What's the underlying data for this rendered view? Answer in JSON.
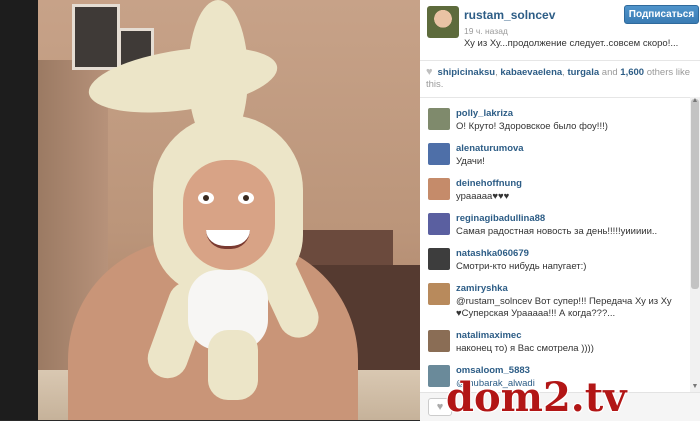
{
  "post": {
    "username": "rustam_solncev",
    "follow_label": "Подписаться",
    "time_ago": "19 ч. назад",
    "caption": "Ху из Ху...продолжение следует..совсем скоро!..."
  },
  "likes": {
    "heart_icon": "heart-icon",
    "likers": [
      "shipicinaksu",
      "kabaevaelena",
      "turgala"
    ],
    "sep1": ", ",
    "sep2": ", ",
    "and_text": " and ",
    "more_count": "1,600",
    "more_text": " others like this."
  },
  "comments": [
    {
      "user": "polly_lakriza",
      "text": "О! Круто! Здоровское было фоу!!!)",
      "avatar_color": "#7f8a6c"
    },
    {
      "user": "alenaturumova",
      "text": "Удачи!",
      "avatar_color": "#4e6fa8"
    },
    {
      "user": "deinehoffnung",
      "text": "урааааа♥♥♥",
      "avatar_color": "#c58b6a"
    },
    {
      "user": "reginagibadullina88",
      "text": "Самая радостная новость за день!!!!!уиииии..",
      "avatar_color": "#5a5fa0"
    },
    {
      "user": "natashka060679",
      "text": "Смотри-кто нибудь напугает:)",
      "avatar_color": "#3d3d3d"
    },
    {
      "user": "zamiryshka",
      "text": "@rustam_solncev Вот супер!!! Передача Ху из Ху",
      "text2": "♥Суперская Урааааа!!! А когда???...",
      "avatar_color": "#b88a5c"
    },
    {
      "user": "natalimaximec",
      "text": "наконец то) я Вас смотрела ))))",
      "avatar_color": "#8a6d55"
    },
    {
      "user": "omsaloom_5883",
      "text": "@mubarak_alwadi",
      "avatar_color": "#6a8a9a"
    }
  ],
  "watermark": "dom2.tv"
}
